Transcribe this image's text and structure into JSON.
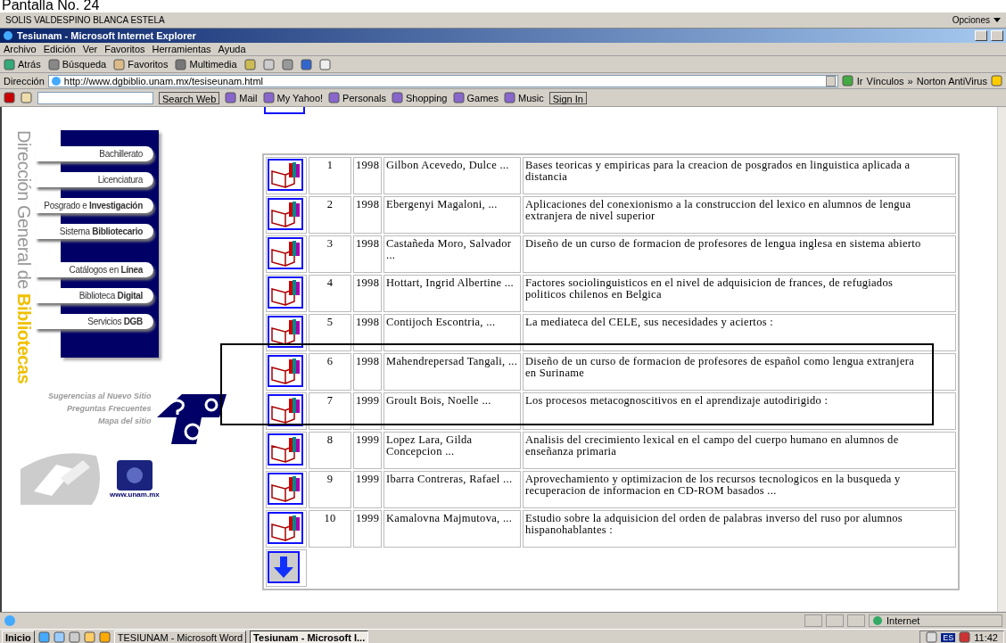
{
  "caption": "Pantalla No. 24",
  "user_bar": {
    "name": "SOLIS VALDESPINO BLANCA ESTELA",
    "options": "Opciones"
  },
  "window": {
    "title": "Tesiunam - Microsoft Internet Explorer"
  },
  "menu": [
    "Archivo",
    "Edición",
    "Ver",
    "Favoritos",
    "Herramientas",
    "Ayuda"
  ],
  "toolbar": [
    "Atrás",
    "Búsqueda",
    "Favoritos",
    "Multimedia"
  ],
  "address": {
    "label": "Dirección",
    "value": "http://www.dgbiblio.unam.mx/tesiseunam.html",
    "go": "Ir",
    "links": "Vínculos",
    "more": "»",
    "norton": "Norton AntiVirus"
  },
  "yahoo_toolbar": {
    "search_button": "Search Web",
    "items": [
      "Mail",
      "My Yahoo!",
      "Personals",
      "Shopping",
      "Games",
      "Music"
    ],
    "sign_in": "Sign In"
  },
  "sidebar": {
    "title": "Dirección General de",
    "title_accent": "Bibliotecas",
    "buttons": [
      "Bachillerato",
      "Licenciatura",
      "Posgrado e **Investigación**",
      "Sistema **Bibliotecario**",
      "Catálogos en **Línea**",
      "Biblioteca **Digital**",
      "Servicios **DGB**"
    ],
    "links": [
      "Sugerencias al Nuevo Sitio",
      "Preguntas Frecuentes",
      "Mapa del sitio"
    ],
    "url": "www.unam.mx"
  },
  "results": {
    "rows": [
      {
        "number": "1",
        "year": "1998",
        "author": "Gilbon Acevedo, Dulce ...",
        "title": "Bases teoricas y empiricas para la creacion de posgrados en linguistica aplicada a distancia"
      },
      {
        "number": "2",
        "year": "1998",
        "author": "Ebergenyi Magaloni, ...",
        "title": "Aplicaciones del conexionismo a la construccion del lexico en alumnos de lengua extranjera de nivel superior"
      },
      {
        "number": "3",
        "year": "1998",
        "author": "Castañeda Moro, Salvador ...",
        "title": "Diseño de un curso de formacion de profesores de lengua inglesa en sistema abierto"
      },
      {
        "number": "4",
        "year": "1998",
        "author": "Hottart, Ingrid Albertine ...",
        "title": "Factores sociolinguisticos en el nivel de adquisicion de frances, de refugiados politicos chilenos en Belgica"
      },
      {
        "number": "5",
        "year": "1998",
        "author": "Contijoch Escontria, ...",
        "title": "La mediateca del CELE, sus necesidades y aciertos :"
      },
      {
        "number": "6",
        "year": "1998",
        "author": "Mahendrepersad Tangali, ...",
        "title": "Diseño de un curso de formacion de profesores de español como lengua extranjera en Suriname"
      },
      {
        "number": "7",
        "year": "1999",
        "author": "Groult Bois, Noelle ...",
        "title": "Los procesos metacognoscitivos en el aprendizaje autodirigido :"
      },
      {
        "number": "8",
        "year": "1999",
        "author": "Lopez Lara, Gilda Concepcion ...",
        "title": "Analisis del crecimiento lexical en el campo del cuerpo humano en alumnos de enseñanza primaria"
      },
      {
        "number": "9",
        "year": "1999",
        "author": "Ibarra Contreras, Rafael ...",
        "title": "Aprovechamiento y optimizacion de los recursos tecnologicos en la busqueda y recuperacion de informacion en CD-ROM basados ..."
      },
      {
        "number": "10",
        "year": "1999",
        "author": "Kamalovna Majmutova, ...",
        "title": "Estudio sobre la adquisicion del orden de palabras inverso del ruso por alumnos hispanohablantes :"
      }
    ]
  },
  "status_bar": {
    "zone": "Internet"
  },
  "taskbar": {
    "start": "Inicio",
    "tasks": [
      {
        "label": "TESIUNAM - Microsoft Word",
        "selected": false
      },
      {
        "label": "Tesiunam - Microsoft I...",
        "selected": true
      }
    ],
    "language": "ES",
    "clock": "11:42"
  }
}
